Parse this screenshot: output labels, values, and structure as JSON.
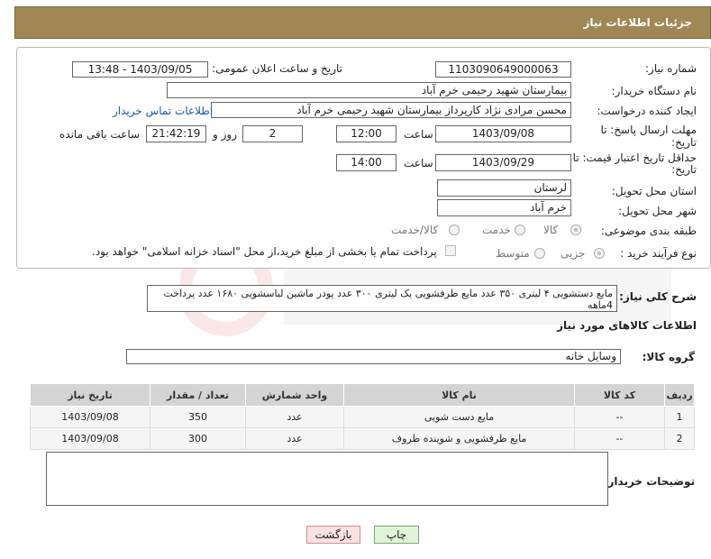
{
  "header": {
    "title": "جزئیات اطلاعات نیاز"
  },
  "form": {
    "need_number": {
      "label": "شماره نیاز:",
      "value": "1103090649000063"
    },
    "announce": {
      "label": "تاریخ و ساعت اعلان عمومی:",
      "value": "1403/09/05 - 13:48"
    },
    "buyer_org": {
      "label": "نام دستگاه خریدار:",
      "value": "بیمارستان شهید رحیمی خرم آباد"
    },
    "requester": {
      "label": "ایجاد کننده درخواست:",
      "value": "محسن مرادی نژاد کارپرداز بیمارستان شهید رحیمی خرم آباد",
      "contact_link": "اطلاعات تماس خریدار"
    },
    "reply_deadline": {
      "label_line1": "مهلت ارسال پاسخ: تا",
      "label_line2": "تاریخ:",
      "date": "1403/09/08",
      "time_label": "ساعت",
      "time": "12:00",
      "days": "2",
      "days_label": "روز و",
      "remaining": "21:42:19",
      "remaining_label": "ساعت باقی مانده"
    },
    "price_validity": {
      "label_line1": "حداقل تاریخ اعتبار قیمت: تا",
      "label_line2": "تاریخ:",
      "date": "1403/09/29",
      "time_label": "ساعت",
      "time": "14:00"
    },
    "province": {
      "label": "استان محل تحویل:",
      "value": "لرستان"
    },
    "city": {
      "label": "شهر محل تحویل:",
      "value": "خرم آباد"
    },
    "category": {
      "label": "طبقه بندی موضوعی:",
      "options": [
        "کالا",
        "خدمت",
        "کالا/خدمت"
      ],
      "selected": "کالا"
    },
    "process": {
      "label": "نوع فرآیند خرید :",
      "options": [
        "جزیی",
        "متوسط"
      ],
      "payment_note": "پرداخت تمام یا بخشی از مبلغ خرید،از محل \"اسناد خزانه اسلامی\" خواهد بود."
    }
  },
  "description": {
    "label": "شرح کلی نیاز:",
    "text": "مایع دستشویی ۴ لیتری ۳۵۰ عدد مایع ظرفشویی یک لیتری ۳۰۰ عدد پودر ماشین لباسشویی ۱۶۸۰ عدد پرداخت 4ماهه"
  },
  "goods": {
    "section_title": "اطلاعات کالاهای مورد نیاز",
    "group_label": "گروه کالا:",
    "group_value": "وسایل خانه",
    "columns": [
      "ردیف",
      "کد کالا",
      "نام کالا",
      "واحد شمارش",
      "تعداد / مقدار",
      "تاریخ نیاز"
    ],
    "rows": [
      [
        "1",
        "--",
        "مایع دست شویی",
        "عدد",
        "350",
        "1403/09/08"
      ],
      [
        "2",
        "--",
        "مایع ظرفشویی و شوینده ظروف",
        "عدد",
        "300",
        "1403/09/08"
      ]
    ]
  },
  "buyer_notes": {
    "label": "توضیحات خریدار:",
    "value": ""
  },
  "buttons": {
    "print": "چاپ",
    "back": "بازگشت"
  },
  "colors": {
    "header_bg": "#a08856",
    "print_bg": "#dff5d8",
    "back_bg": "#fbe1e1",
    "link": "#1a56b0"
  }
}
